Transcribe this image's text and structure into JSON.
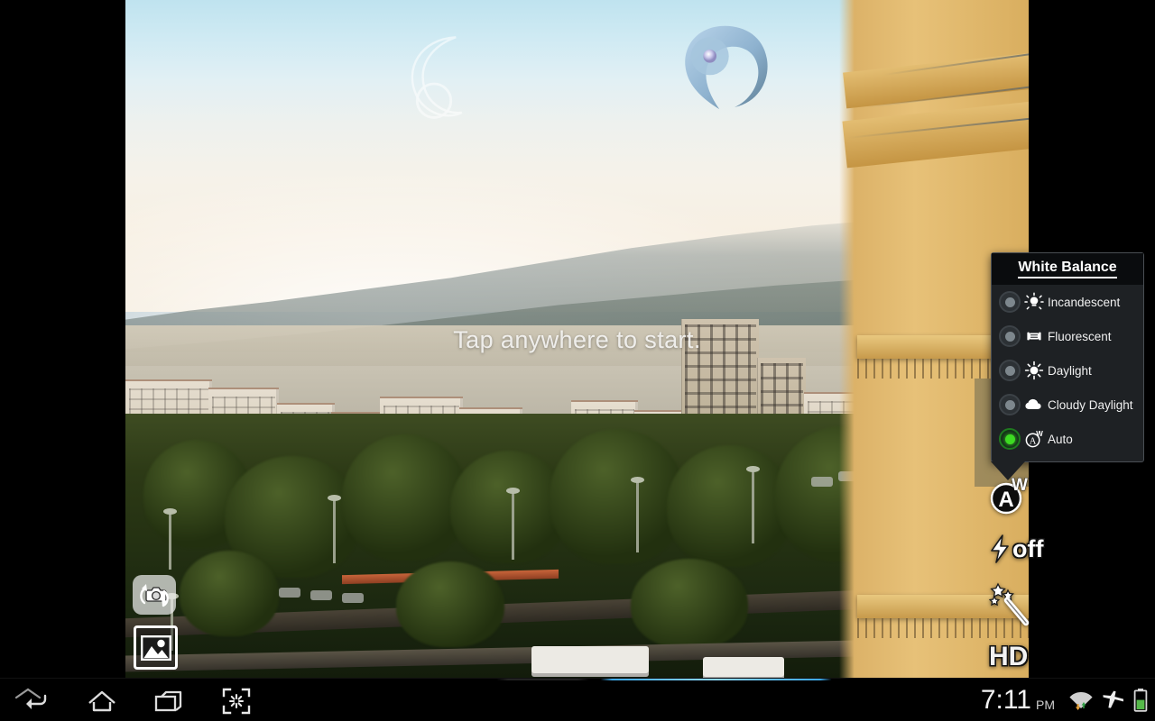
{
  "app": {
    "name": "Camera",
    "hint_text": "Tap anywhere to start."
  },
  "preview": {
    "scene_description": "Live camera preview of a city skyline at dusk with hills, apartment blocks, a tree-lined boulevard and a yellow building at the right edge",
    "watermark_left_icon": "yin-yang-swirl-icon",
    "watermark_right_icon": "yin-yang-swirl-icon"
  },
  "left_controls": [
    {
      "name": "switch-camera-button",
      "icon": "switch-camera-icon",
      "label": ""
    },
    {
      "name": "gallery-button",
      "icon": "photo-thumbnail-icon",
      "label": ""
    }
  ],
  "right_controls": [
    {
      "name": "white-balance-button",
      "icon": "auto-white-balance-icon",
      "label": "AW",
      "sub": "W"
    },
    {
      "name": "flash-button",
      "icon": "flash-icon",
      "label": "off"
    },
    {
      "name": "effects-button",
      "icon": "magic-wand-icon",
      "label": ""
    },
    {
      "name": "video-quality-button",
      "icon": "hd-icon",
      "label": "HD"
    }
  ],
  "white_balance_popup": {
    "title": "White Balance",
    "selected": "Auto",
    "accent_color": "#3ddb22",
    "background_color": "#1e2124",
    "title_background_color": "#0a0c0e",
    "options": [
      {
        "label": "Incandescent",
        "icon": "incandescent-bulb-icon",
        "selected": false
      },
      {
        "label": "Fluorescent",
        "icon": "fluorescent-tube-icon",
        "selected": false
      },
      {
        "label": "Daylight",
        "icon": "sun-icon",
        "selected": false
      },
      {
        "label": "Cloudy Daylight",
        "icon": "cloud-icon",
        "selected": false
      },
      {
        "label": "Auto",
        "icon": "auto-wb-icon",
        "selected": true
      }
    ]
  },
  "system_bar": {
    "nav": [
      {
        "name": "back-button",
        "icon": "back-arrow-icon"
      },
      {
        "name": "home-button",
        "icon": "home-icon"
      },
      {
        "name": "recent-apps-button",
        "icon": "recent-apps-icon"
      },
      {
        "name": "screenshot-button",
        "icon": "screenshot-icon"
      }
    ],
    "expand_icon": "chevron-up-icon",
    "status": {
      "time": "7:11",
      "meridiem": "PM",
      "icons": [
        {
          "name": "wifi-icon",
          "label": "wifi-with-transfer-arrows"
        },
        {
          "name": "airplane-mode-icon",
          "label": "airplane-mode"
        },
        {
          "name": "battery-icon",
          "label": "battery"
        }
      ]
    }
  }
}
